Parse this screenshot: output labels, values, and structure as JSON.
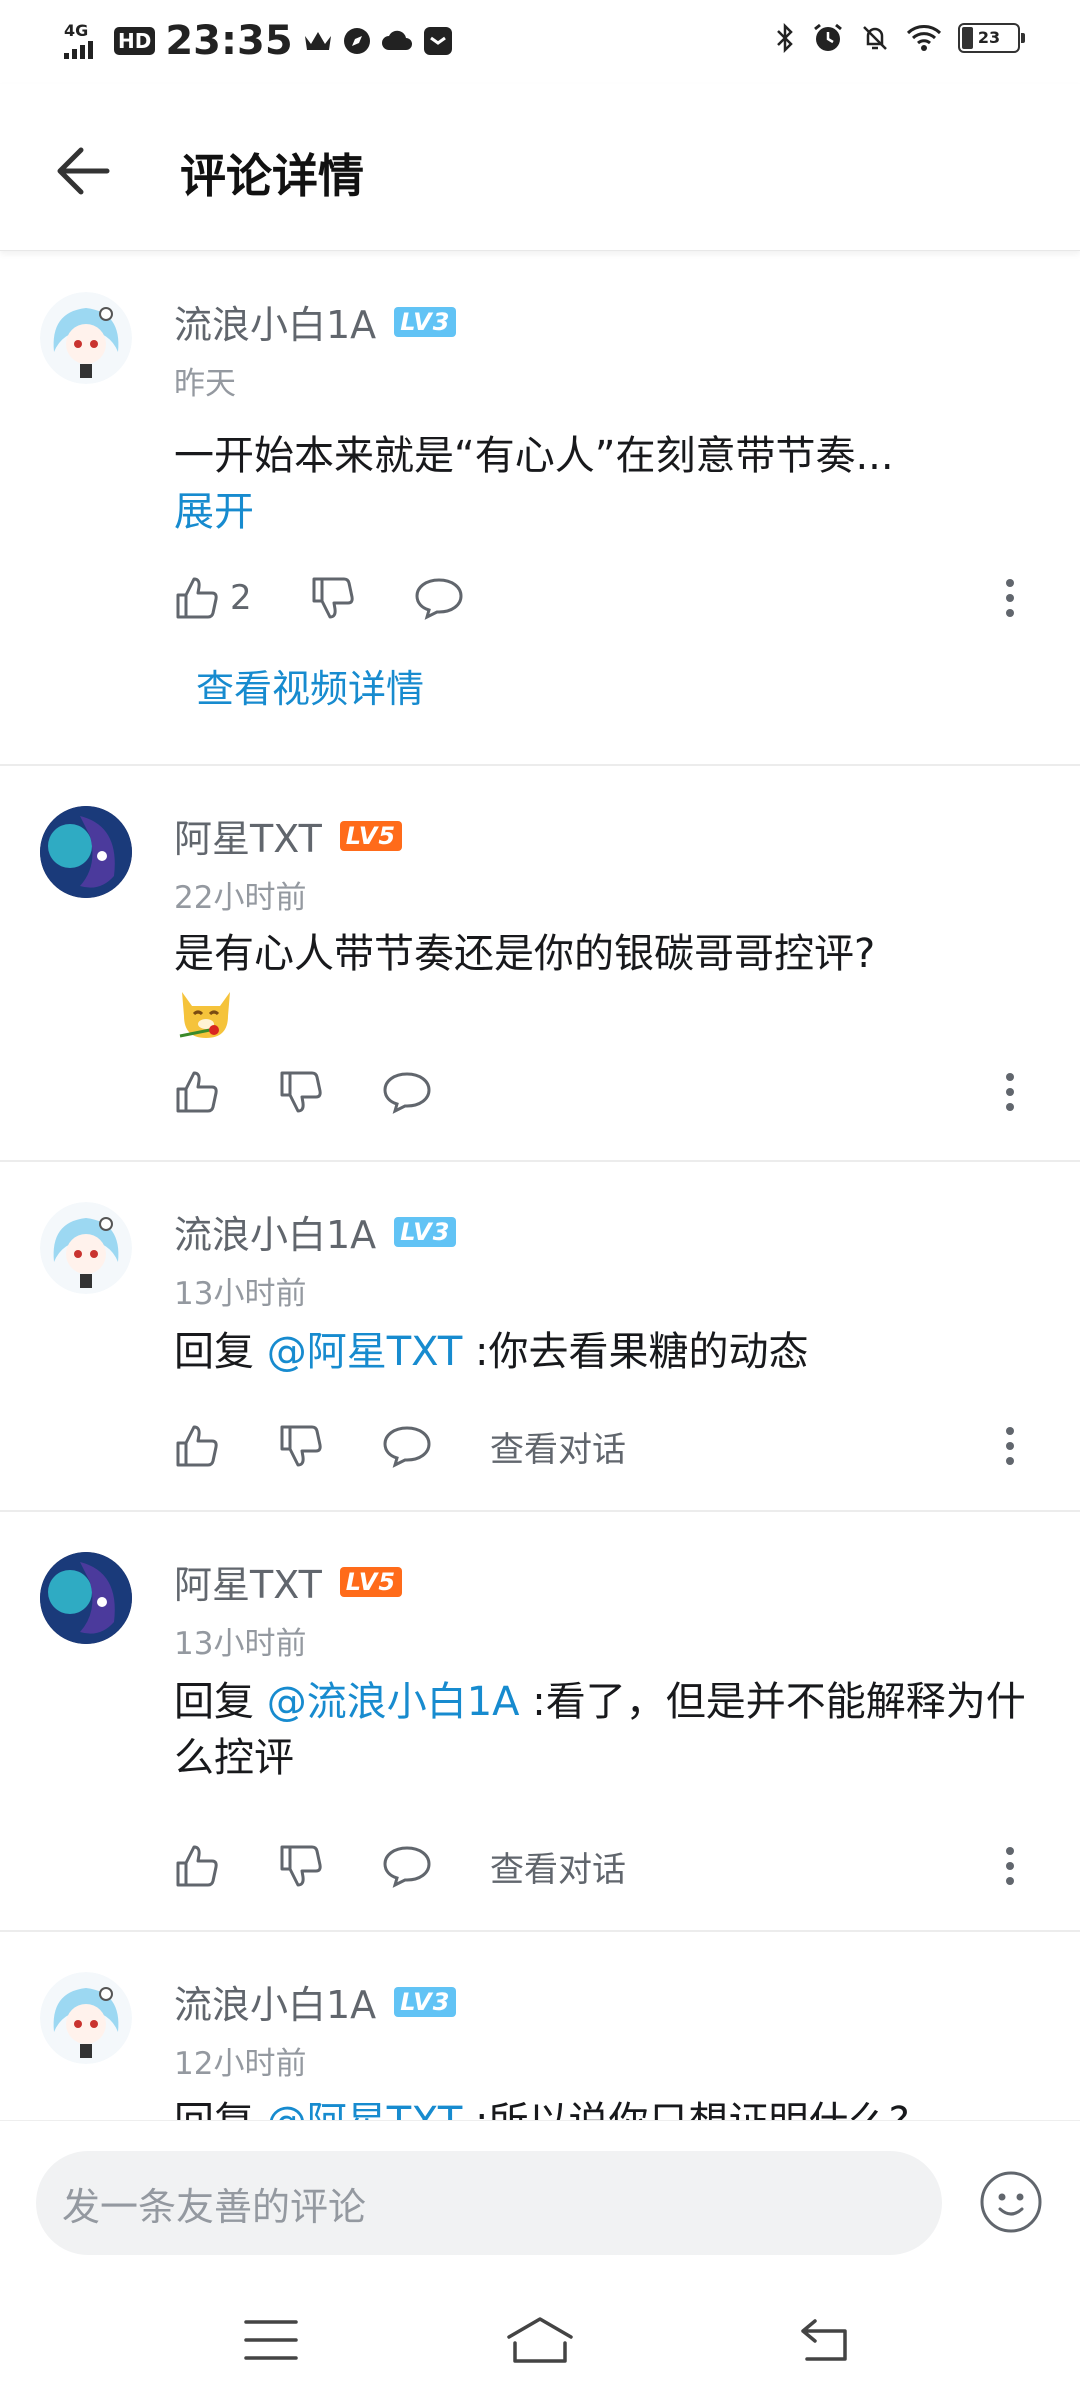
{
  "status_bar": {
    "network": "4G",
    "hd": "HD",
    "time": "23:35",
    "battery": "23"
  },
  "header": {
    "title": "评论详情"
  },
  "comments": [
    {
      "username": "流浪小白1A",
      "level": "LV3",
      "time": "昨天",
      "text": "一开始本来就是“有心人”在刻意带节奏...",
      "expand": "展开",
      "likes": "2",
      "link": "查看视频详情"
    },
    {
      "username": "阿星TXT",
      "level": "LV5",
      "time": "22小时前",
      "text": "是有心人带节奏还是你的银碳哥哥控评?"
    },
    {
      "username": "流浪小白1A",
      "level": "LV3",
      "time": "13小时前",
      "reply_prefix": "回复 ",
      "mention": "@阿星TXT",
      "text": " :你去看果糖的动态",
      "view_conversation": "查看对话"
    },
    {
      "username": "阿星TXT",
      "level": "LV5",
      "time": "13小时前",
      "reply_prefix": "回复 ",
      "mention": "@流浪小白1A",
      "text": " :看了，但是并不能解释为什么控评",
      "view_conversation": "查看对话"
    },
    {
      "username": "流浪小白1A",
      "level": "LV3",
      "time": "12小时前",
      "reply_prefix": "回复 ",
      "mention": "@阿星TXT",
      "text": " :所以说你只想证明什么?"
    }
  ],
  "input": {
    "placeholder": "发一条友善的评论"
  },
  "colors": {
    "accent": "#178bcf",
    "lv3": "#61c3f5",
    "lv5": "#ff6b1a",
    "secondary_text": "#9499a0"
  }
}
